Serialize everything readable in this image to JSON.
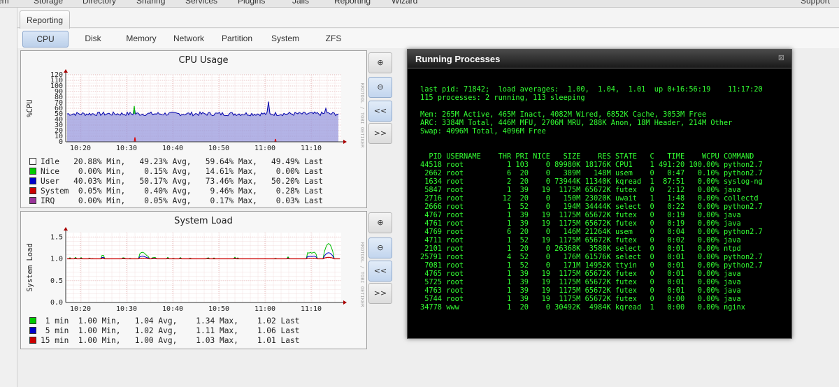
{
  "topbar": [
    "em",
    "Storage",
    "Directory",
    "Sharing",
    "Services",
    "Plugins",
    "Jails",
    "Reporting",
    "Wizard",
    "Support"
  ],
  "reporting_tab": "Reporting",
  "subtabs": [
    "CPU",
    "Disk",
    "Memory",
    "Network",
    "Partition",
    "System",
    "ZFS"
  ],
  "active_subtab": "CPU",
  "cpu_panel": {
    "title": "CPU Usage",
    "ylabel": "%CPU",
    "side": "RRDTOOL / TOBI OETIKER",
    "yticks": [
      "0",
      "10",
      "20",
      "30",
      "40",
      "50",
      "60",
      "70",
      "80",
      "90",
      "100",
      "110",
      "120"
    ],
    "xticks": [
      "10:20",
      "10:30",
      "10:40",
      "10:50",
      "11:00",
      "11:10"
    ],
    "legend": [
      {
        "name": "Idle",
        "color": "#ffffff",
        "stats": "   20.88% Min,   49.23% Avg,   59.64% Max,   49.49% Last"
      },
      {
        "name": "Nice",
        "color": "#00cc00",
        "stats": "    0.00% Min,    0.15% Avg,   14.61% Max,    0.00% Last"
      },
      {
        "name": "User",
        "color": "#0000cc",
        "stats": "   40.03% Min,   50.17% Avg,   73.46% Max,   50.20% Last"
      },
      {
        "name": "System",
        "color": "#cc0000",
        "stats": "  0.05% Min,    0.40% Avg,    9.46% Max,    0.28% Last"
      },
      {
        "name": "IRQ",
        "color": "#993399",
        "stats": "     0.00% Min,    0.05% Avg,    0.17% Max,    0.03% Last"
      }
    ]
  },
  "load_panel": {
    "title": "System Load",
    "ylabel": "System Load",
    "side": "RRDTOOL / TOBI OETIKER",
    "yticks": [
      "0.0",
      "0.5",
      "1.0",
      "1.5"
    ],
    "xticks": [
      "10:20",
      "10:30",
      "10:40",
      "10:50",
      "11:00",
      "11:10"
    ],
    "legend": [
      {
        "name": " 1 min",
        "color": "#00cc00",
        "stats": "  1.00 Min,   1.04 Avg,    1.34 Max,    1.02 Last"
      },
      {
        "name": " 5 min",
        "color": "#0000cc",
        "stats": "  1.00 Min,   1.02 Avg,    1.11 Max,    1.06 Last"
      },
      {
        "name": "15 min",
        "color": "#cc0000",
        "stats": "  1.00 Min,   1.00 Avg,    1.03 Max,    1.01 Last"
      }
    ]
  },
  "nav_buttons": {
    "zoom_in": "⊕",
    "zoom_out": "⊖",
    "back": "<<",
    "forward": ">>"
  },
  "modal": {
    "title": "Running Processes",
    "close": "⊠",
    "lines": [
      "last pid: 71842;  load averages:  1.00,  1.04,  1.01  up 0+16:56:19    11:17:20",
      "115 processes: 2 running, 113 sleeping",
      "",
      "Mem: 265M Active, 465M Inact, 4082M Wired, 6852K Cache, 3053M Free",
      "ARC: 3384M Total, 446M MFU, 2706M MRU, 288K Anon, 18M Header, 214M Other",
      "Swap: 4096M Total, 4096M Free",
      "",
      "",
      "  PID USERNAME    THR PRI NICE   SIZE    RES STATE   C   TIME    WCPU COMMAND",
      "44518 root          1 103    0 89980K 18176K CPU1    1 491:20 100.00% python2.7",
      " 2662 root          6  20    0   389M   148M usem    0   0:47   0.10% python2.7",
      " 1634 root          2  20    0 73944K 11340K kqread  1  87:51   0.00% syslog-ng",
      " 5847 root          1  39   19  1175M 65672K futex   0   2:12   0.00% java",
      " 2716 root         12  20    0   150M 23020K uwait   1   1:48   0.00% collectd",
      " 2666 root          1  52    0   194M 34444K select  0   0:22   0.00% python2.7",
      " 4767 root          1  39   19  1175M 65672K futex   0   0:19   0.00% java",
      " 4761 root          1  39   19  1175M 65672K futex   0   0:19   0.00% java",
      " 4769 root          6  20    0   146M 21264K usem    0   0:04   0.00% python2.7",
      " 4711 root          1  52   19  1175M 65672K futex   0   0:02   0.00% java",
      " 2101 root          1  20    0 26368K  3580K select  0   0:01   0.00% ntpd",
      "25791 root          4  52    0   176M 61576K select  0   0:01   0.00% python2.7",
      " 7081 root          1  52    0   171M 14952K ttyin   0   0:01   0.00% python2.7",
      " 4765 root          1  39   19  1175M 65672K futex   0   0:01   0.00% java",
      " 5725 root          1  39   19  1175M 65672K futex   0   0:01   0.00% java",
      " 4763 root          1  39   19  1175M 65672K futex   0   0:01   0.00% java",
      " 5744 root          1  39   19  1175M 65672K futex   0   0:00   0.00% java",
      "34778 www           1  20    0 30492K  4984K kqread  1   0:00   0.00% nginx"
    ]
  },
  "chart_data": [
    {
      "type": "area",
      "title": "CPU Usage",
      "ylabel": "%CPU",
      "ylim": [
        0,
        120
      ],
      "x_ticks": [
        "10:20",
        "10:30",
        "10:40",
        "10:50",
        "11:00",
        "11:10"
      ],
      "grid": true,
      "series": [
        {
          "name": "User",
          "color": "#0000cc",
          "summary": {
            "min": 40.03,
            "avg": 50.17,
            "max": 73.46,
            "last": 50.2
          }
        },
        {
          "name": "Nice",
          "color": "#00cc00",
          "summary": {
            "min": 0.0,
            "avg": 0.15,
            "max": 14.61,
            "last": 0.0
          }
        },
        {
          "name": "System",
          "color": "#cc0000",
          "summary": {
            "min": 0.05,
            "avg": 0.4,
            "max": 9.46,
            "last": 0.28
          }
        },
        {
          "name": "IRQ",
          "color": "#993399",
          "summary": {
            "min": 0.0,
            "avg": 0.05,
            "max": 0.17,
            "last": 0.03
          }
        },
        {
          "name": "Idle",
          "color": "#ffffff",
          "summary": {
            "min": 20.88,
            "avg": 49.23,
            "max": 59.64,
            "last": 49.49
          }
        }
      ]
    },
    {
      "type": "line",
      "title": "System Load",
      "ylabel": "System Load",
      "ylim": [
        0,
        1.6
      ],
      "x_ticks": [
        "10:20",
        "10:30",
        "10:40",
        "10:50",
        "11:00",
        "11:10"
      ],
      "grid": true,
      "series": [
        {
          "name": "1 min",
          "color": "#00cc00",
          "summary": {
            "min": 1.0,
            "avg": 1.04,
            "max": 1.34,
            "last": 1.02
          }
        },
        {
          "name": "5 min",
          "color": "#0000cc",
          "summary": {
            "min": 1.0,
            "avg": 1.02,
            "max": 1.11,
            "last": 1.06
          }
        },
        {
          "name": "15 min",
          "color": "#cc0000",
          "summary": {
            "min": 1.0,
            "avg": 1.0,
            "max": 1.03,
            "last": 1.01
          }
        }
      ]
    }
  ]
}
